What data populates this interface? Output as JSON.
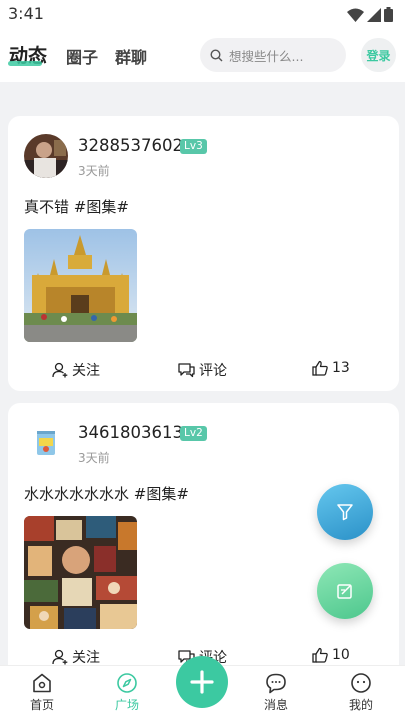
{
  "status_bar": {
    "time": "3:41"
  },
  "header": {
    "tabs": [
      {
        "label": "动态",
        "active": true
      },
      {
        "label": "圈子",
        "active": false
      },
      {
        "label": "群聊",
        "active": false
      }
    ],
    "search_placeholder": "想搜些什么...",
    "login_label": "登录"
  },
  "posts": [
    {
      "username": "3288537602",
      "level": "Lv3",
      "time": "3天前",
      "content": "真不错 #图集#",
      "actions": {
        "follow": "关注",
        "comment": "评论",
        "likes": "13"
      }
    },
    {
      "username": "3461803613",
      "level": "Lv2",
      "time": "3天前",
      "content": "水水水水水水水 #图集#",
      "actions": {
        "follow": "关注",
        "comment": "评论",
        "likes": "10"
      }
    }
  ],
  "bottom_nav": [
    {
      "label": "首页",
      "icon": "home-icon",
      "active": false
    },
    {
      "label": "广场",
      "icon": "compass-icon",
      "active": true
    },
    {
      "label": "消息",
      "icon": "chat-icon",
      "active": false
    },
    {
      "label": "我的",
      "icon": "profile-icon",
      "active": false
    }
  ],
  "colors": {
    "accent": "#3cc9a1",
    "level_badge": "#58c7a9"
  }
}
